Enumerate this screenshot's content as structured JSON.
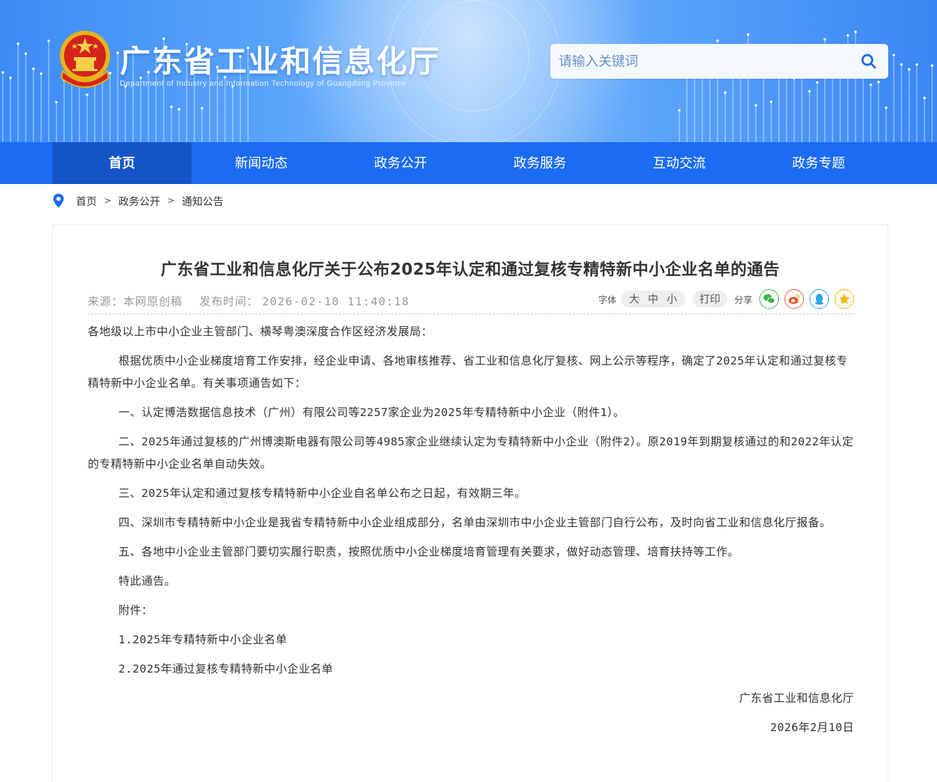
{
  "header": {
    "site_title": "广东省工业和信息化厅",
    "site_subtitle": "Department of Industry and Information Technology of Guangdong Province",
    "search_placeholder": "请输入关键词"
  },
  "nav": {
    "items": [
      {
        "label": "首页",
        "active": true
      },
      {
        "label": "新闻动态"
      },
      {
        "label": "政务公开"
      },
      {
        "label": "政务服务"
      },
      {
        "label": "互动交流"
      },
      {
        "label": "政务专题"
      }
    ]
  },
  "breadcrumb": {
    "items": [
      "首页",
      "政务公开",
      "通知公告"
    ],
    "separator": ">"
  },
  "article": {
    "title": "广东省工业和信息化厅关于公布2025年认定和通过复核专精特新中小企业名单的通告",
    "source_label": "来源：",
    "source": "本网原创稿",
    "publish_label": "发布时间：",
    "publish_time": "2026-02-10 11:40:18",
    "font_label": "字体",
    "font_sizes": [
      "大",
      "中",
      "小"
    ],
    "print_label": "打印",
    "share_label": "分享",
    "share_icons": [
      "wechat-icon",
      "weibo-icon",
      "qq-icon",
      "qzone-icon"
    ],
    "paragraphs": [
      {
        "text": "各地级以上市中小企业主管部门、横琴粤澳深度合作区经济发展局：",
        "style": "plain"
      },
      {
        "text": "根据优质中小企业梯度培育工作安排，经企业申请、各地审核推荐、省工业和信息化厅复核、网上公示等程序，确定了2025年认定和通过复核专精特新中小企业名单。有关事项通告如下：",
        "style": "indent"
      },
      {
        "text": "一、认定博浩数据信息技术（广州）有限公司等2257家企业为2025年专精特新中小企业（附件1）。",
        "style": "indent"
      },
      {
        "text": "二、2025年通过复核的广州博澳斯电器有限公司等4985家企业继续认定为专精特新中小企业（附件2）。原2019年到期复核通过的和2022年认定的专精特新中小企业名单自动失效。",
        "style": "indent"
      },
      {
        "text": "三、2025年认定和通过复核专精特新中小企业自名单公布之日起，有效期三年。",
        "style": "indent"
      },
      {
        "text": "四、深圳市专精特新中小企业是我省专精特新中小企业组成部分，名单由深圳市中小企业主管部门自行公布，及时向省工业和信息化厅报备。",
        "style": "indent"
      },
      {
        "text": "五、各地中小企业主管部门要切实履行职责，按照优质中小企业梯度培育管理有关要求，做好动态管理、培育扶持等工作。",
        "style": "indent"
      },
      {
        "text": "特此通告。",
        "style": "indent"
      },
      {
        "text": "附件：",
        "style": "indent"
      },
      {
        "text": "1.2025年专精特新中小企业名单",
        "style": "indent",
        "link": true
      },
      {
        "text": "2.2025年通过复核专精特新中小企业名单",
        "style": "indent",
        "link": true
      },
      {
        "text": "广东省工业和信息化厅",
        "style": "right"
      },
      {
        "text": "2026年2月10日",
        "style": "right"
      }
    ]
  },
  "colors": {
    "nav_bg": "#1c6bf3",
    "nav_active_bg": "#1454c8",
    "accent": "#1c6bf3",
    "wechat": "#3bb44a",
    "weibo": "#e8542e",
    "qq": "#2aa3e3",
    "qzone": "#f4b400"
  }
}
